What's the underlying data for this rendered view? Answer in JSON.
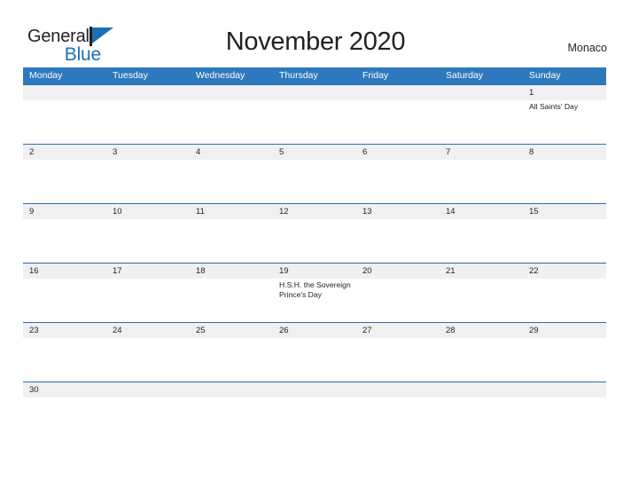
{
  "brand": {
    "name_part1": "General",
    "name_part2": "Blue",
    "flag_icon": "flag-triangle-icon",
    "color_dark": "#231f20",
    "color_blue": "#1b6fb3"
  },
  "header": {
    "title": "November 2020",
    "region": "Monaco"
  },
  "colors": {
    "header_blue": "#2e79bd",
    "row_rule_blue": "#2a6eb5",
    "day_band_gray": "#f0f0f0",
    "text": "#231f20"
  },
  "calendar": {
    "weekdays": [
      "Monday",
      "Tuesday",
      "Wednesday",
      "Thursday",
      "Friday",
      "Saturday",
      "Sunday"
    ],
    "weeks": [
      [
        {
          "day": "",
          "event": ""
        },
        {
          "day": "",
          "event": ""
        },
        {
          "day": "",
          "event": ""
        },
        {
          "day": "",
          "event": ""
        },
        {
          "day": "",
          "event": ""
        },
        {
          "day": "",
          "event": ""
        },
        {
          "day": "1",
          "event": "All Saints' Day"
        }
      ],
      [
        {
          "day": "2",
          "event": ""
        },
        {
          "day": "3",
          "event": ""
        },
        {
          "day": "4",
          "event": ""
        },
        {
          "day": "5",
          "event": ""
        },
        {
          "day": "6",
          "event": ""
        },
        {
          "day": "7",
          "event": ""
        },
        {
          "day": "8",
          "event": ""
        }
      ],
      [
        {
          "day": "9",
          "event": ""
        },
        {
          "day": "10",
          "event": ""
        },
        {
          "day": "11",
          "event": ""
        },
        {
          "day": "12",
          "event": ""
        },
        {
          "day": "13",
          "event": ""
        },
        {
          "day": "14",
          "event": ""
        },
        {
          "day": "15",
          "event": ""
        }
      ],
      [
        {
          "day": "16",
          "event": ""
        },
        {
          "day": "17",
          "event": ""
        },
        {
          "day": "18",
          "event": ""
        },
        {
          "day": "19",
          "event": "H.S.H. the Sovereign Prince's Day"
        },
        {
          "day": "20",
          "event": ""
        },
        {
          "day": "21",
          "event": ""
        },
        {
          "day": "22",
          "event": ""
        }
      ],
      [
        {
          "day": "23",
          "event": ""
        },
        {
          "day": "24",
          "event": ""
        },
        {
          "day": "25",
          "event": ""
        },
        {
          "day": "26",
          "event": ""
        },
        {
          "day": "27",
          "event": ""
        },
        {
          "day": "28",
          "event": ""
        },
        {
          "day": "29",
          "event": ""
        }
      ],
      [
        {
          "day": "30",
          "event": ""
        },
        {
          "day": "",
          "event": ""
        },
        {
          "day": "",
          "event": ""
        },
        {
          "day": "",
          "event": ""
        },
        {
          "day": "",
          "event": ""
        },
        {
          "day": "",
          "event": ""
        },
        {
          "day": "",
          "event": ""
        }
      ]
    ]
  }
}
